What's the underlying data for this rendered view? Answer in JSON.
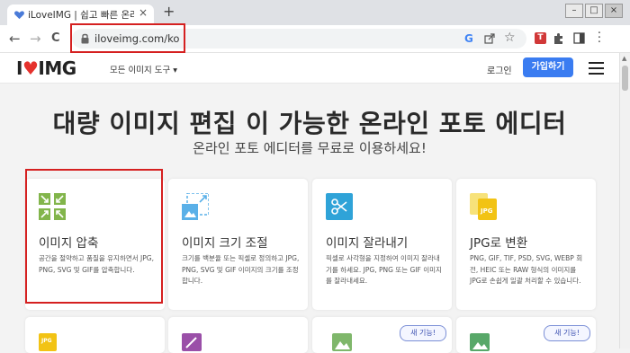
{
  "browser": {
    "tab_title": "iLoveIMG | 쉽고 빠른 온라인 무",
    "tab_close": "×",
    "new_tab": "+",
    "url": "iloveimg.com/ko",
    "window_controls": [
      "–",
      "□",
      "×"
    ],
    "nav": [
      "←",
      "→",
      "C"
    ],
    "toolbar_icons": [
      "google-icon",
      "share-icon",
      "star-icon",
      "extension-red-icon",
      "puzzle-icon",
      "sidebar-icon",
      "menu-dots-icon"
    ]
  },
  "header": {
    "logo_left": "I",
    "logo_heart": "♥",
    "logo_right": "IMG",
    "tools_menu": "모든 이미지 도구 ▾",
    "login": "로그인",
    "signup": "가입하기"
  },
  "hero": {
    "title": "대량 이미지 편집 이 가능한 온라인 포토 에디터",
    "subtitle": "온라인 포토 에디터를 무료로 이용하세요!"
  },
  "cards": [
    {
      "title": "이미지 압축",
      "desc": "공간을 절약하고 품질을 유지하면서 JPG, PNG, SVG 및 GIF를 압축합니다.",
      "icon": "compress-icon",
      "color": "#82b54b"
    },
    {
      "title": "이미지 크기 조절",
      "desc": "크기를 백분율 또는 픽셀로 정의하고 JPG, PNG, SVG 및 GIF 이미지의 크기를 조정합니다.",
      "icon": "resize-icon",
      "color": "#5ab0e8"
    },
    {
      "title": "이미지 잘라내기",
      "desc": "픽셀로 사각형을 지정하여 이미지 잘라내기를 하세요. JPG, PNG 또는 GIF 이미지를 잘라내세요.",
      "icon": "crop-icon",
      "color": "#2fa3d8"
    },
    {
      "title": "JPG로 변환",
      "desc": "PNG, GIF, TIF, PSD, SVG, WEBP 회전, HEIC 또는 RAW 형식의 이미지를 JPG로 손쉽게 일괄 처리할 수 있습니다.",
      "icon": "to-jpg-icon",
      "color": "#f2c314"
    }
  ],
  "row2": {
    "badge": "새 기능!"
  }
}
